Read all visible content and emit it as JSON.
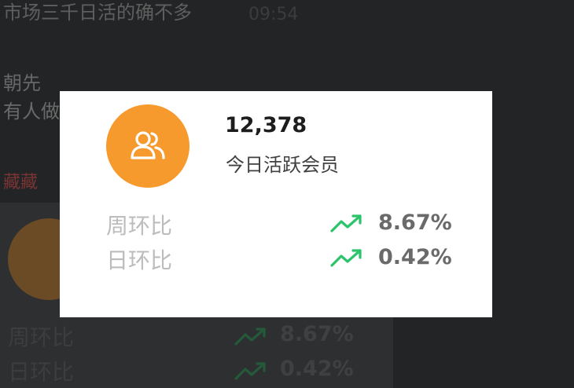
{
  "background": {
    "chat_line1": "市场三千日活的确不多",
    "chat_time": "09:54",
    "chat_name": "朝先",
    "chat_line2": "有人做",
    "chat_red": "藏藏"
  },
  "card": {
    "members_count": "12,378",
    "members_label": "今日活跃会员",
    "icon": "users-icon",
    "accent_color": "#f79a2d",
    "trend_color": "#2bc46a",
    "stats": [
      {
        "label": "周环比",
        "value": "8.67%",
        "trend": "up"
      },
      {
        "label": "日环比",
        "value": "0.42%",
        "trend": "up"
      }
    ]
  },
  "ghost_card": {
    "stats": [
      {
        "label": "周环比",
        "value": "8.67%"
      },
      {
        "label": "日环比",
        "value": "0.42%"
      }
    ]
  }
}
